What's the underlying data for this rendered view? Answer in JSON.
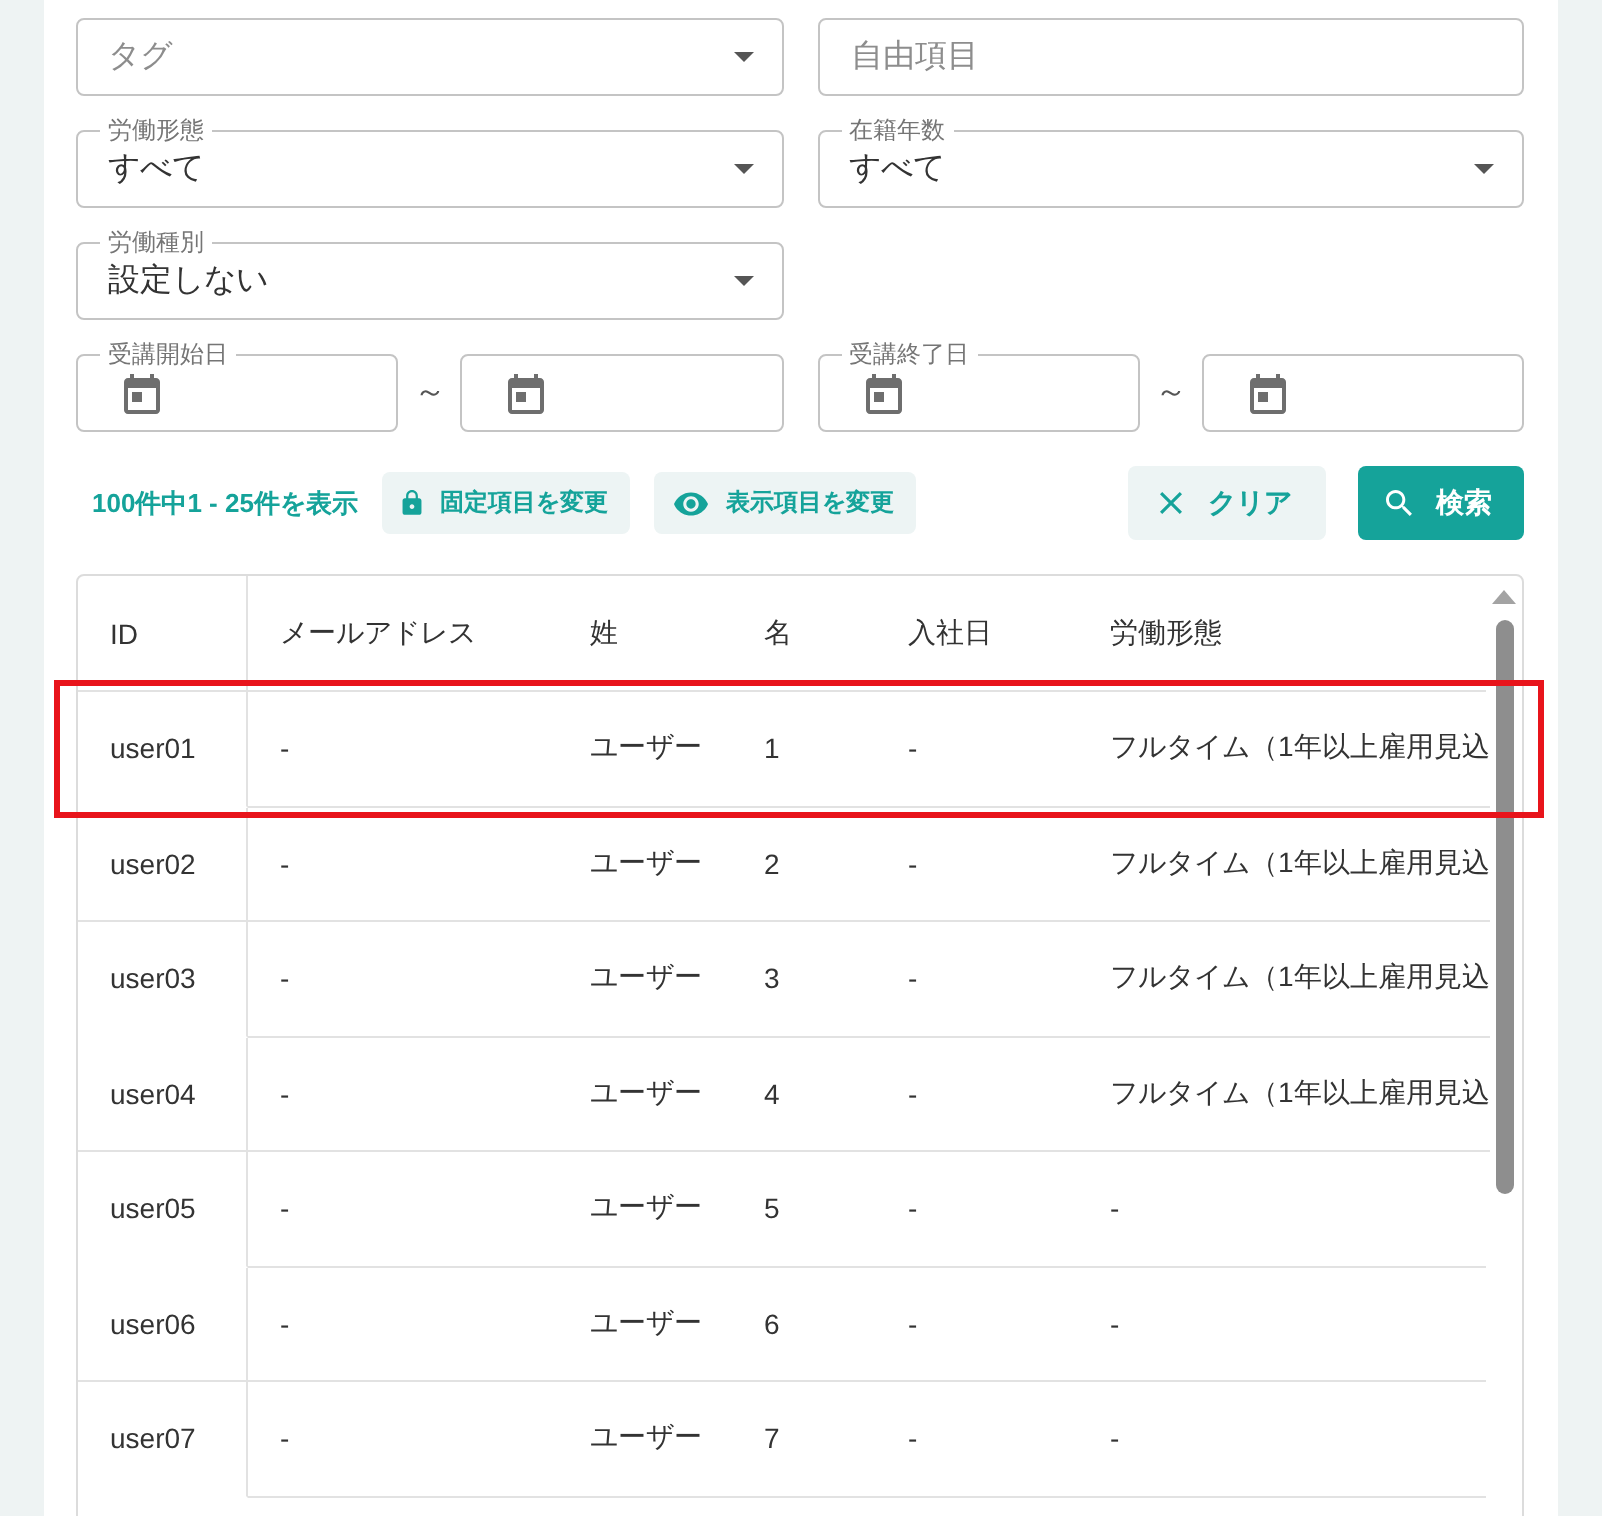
{
  "filters": [
    [
      {
        "kind": "select",
        "placeholder": "タグ"
      },
      {
        "kind": "text",
        "placeholder": "自由項目"
      }
    ],
    [
      {
        "kind": "select",
        "label": "労働形態",
        "value": "すべて"
      },
      {
        "kind": "select",
        "label": "在籍年数",
        "value": "すべて"
      }
    ],
    [
      {
        "kind": "select",
        "label": "労働種別",
        "value": "設定しない"
      }
    ],
    [
      {
        "kind": "date_range",
        "label": "受講開始日",
        "separator": "～"
      },
      {
        "kind": "date_range",
        "label": "受講終了日",
        "separator": "～"
      }
    ]
  ],
  "toolbar": {
    "result_count": "100件中1 - 25件を表示",
    "column_buttons": [
      {
        "kind": "fixed_columns",
        "label": "固定項目を変更"
      },
      {
        "kind": "visible_columns",
        "label": "表示項目を変更"
      }
    ],
    "action_buttons": [
      {
        "kind": "clear",
        "label": "クリア"
      },
      {
        "kind": "search",
        "label": "検索"
      }
    ]
  },
  "table": {
    "columns": [
      "ID",
      "メールアドレス",
      "姓",
      "名",
      "入社日",
      "労働形態"
    ],
    "rows": [
      {
        "cells": [
          "user01",
          "-",
          "ユーザー",
          "1",
          "-",
          "フルタイム（1年以上雇用見込"
        ],
        "highlighted": true
      },
      {
        "cells": [
          "user02",
          "-",
          "ユーザー",
          "2",
          "-",
          "フルタイム（1年以上雇用見込"
        ],
        "highlighted": false
      },
      {
        "cells": [
          "user03",
          "-",
          "ユーザー",
          "3",
          "-",
          "フルタイム（1年以上雇用見込"
        ],
        "highlighted": false
      },
      {
        "cells": [
          "user04",
          "-",
          "ユーザー",
          "4",
          "-",
          "フルタイム（1年以上雇用見込"
        ],
        "highlighted": false
      },
      {
        "cells": [
          "user05",
          "-",
          "ユーザー",
          "5",
          "-",
          "-"
        ],
        "highlighted": false
      },
      {
        "cells": [
          "user06",
          "-",
          "ユーザー",
          "6",
          "-",
          "-"
        ],
        "highlighted": false
      },
      {
        "cells": [
          "user07",
          "-",
          "ユーザー",
          "7",
          "-",
          "-"
        ],
        "highlighted": false
      }
    ]
  }
}
